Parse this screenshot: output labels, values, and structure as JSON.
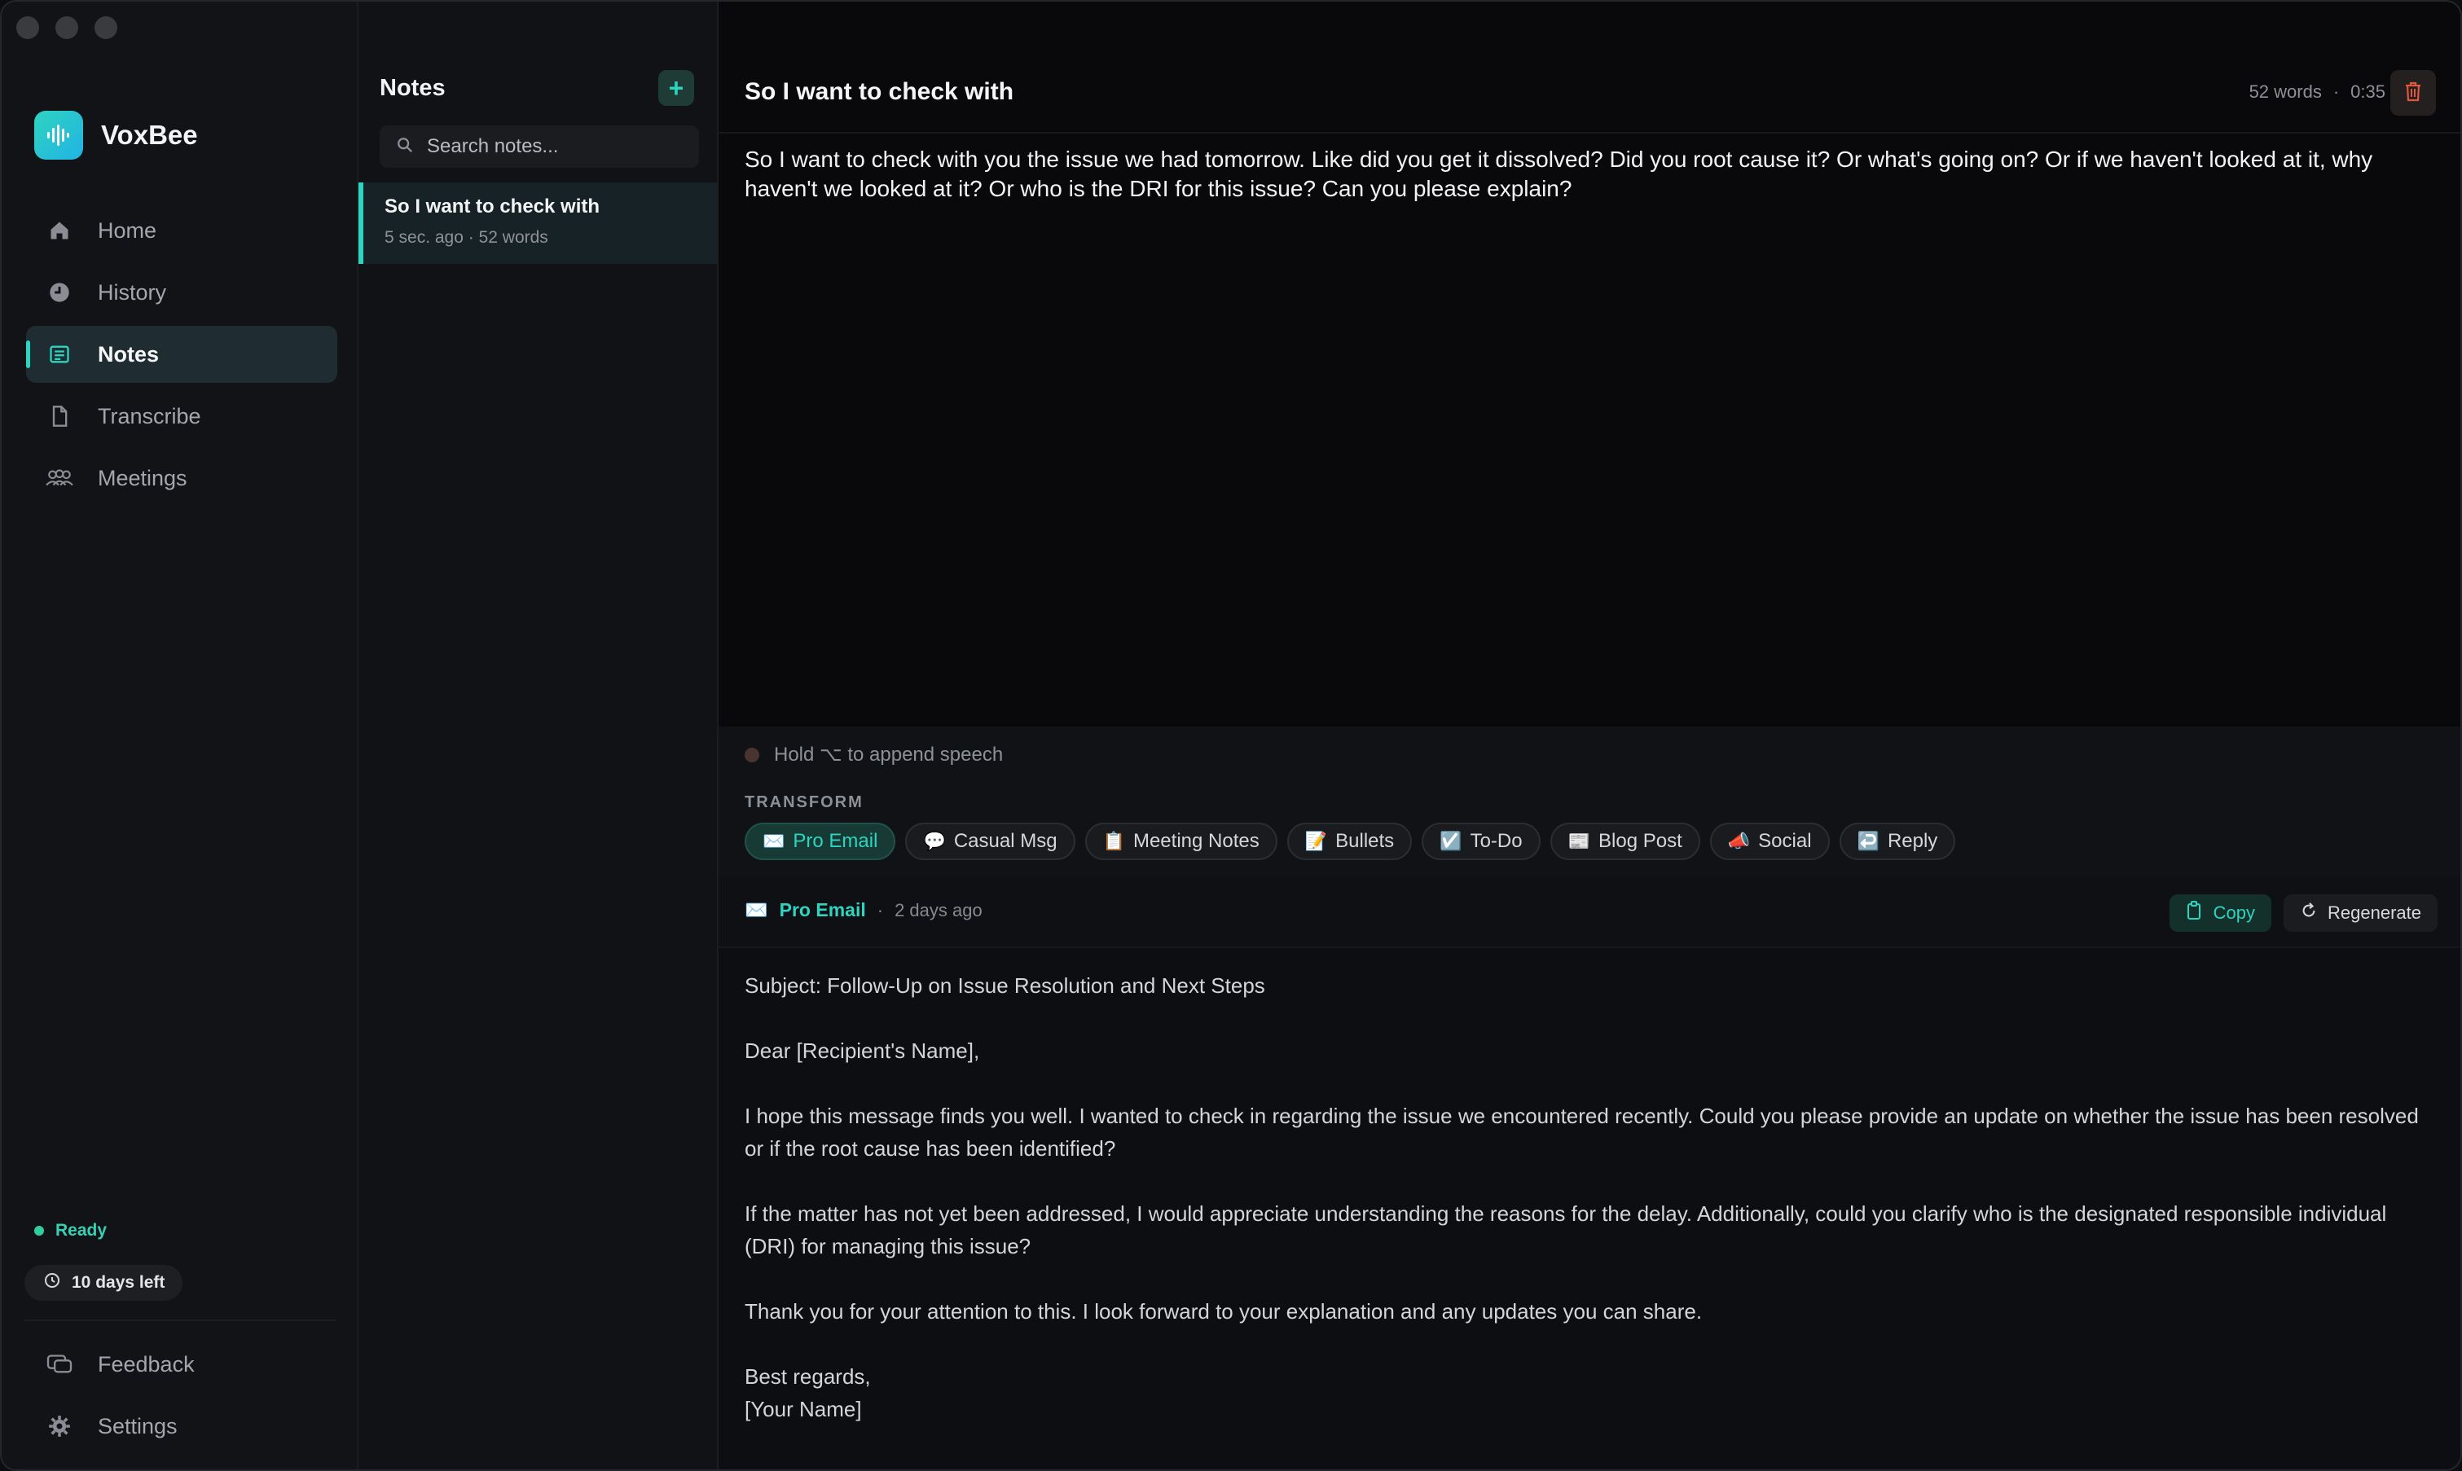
{
  "app": {
    "name": "VoxBee"
  },
  "sidebar": {
    "items": [
      {
        "label": "Home",
        "icon": "home-icon"
      },
      {
        "label": "History",
        "icon": "history-icon"
      },
      {
        "label": "Notes",
        "icon": "notes-icon",
        "active": true
      },
      {
        "label": "Transcribe",
        "icon": "file-icon"
      },
      {
        "label": "Meetings",
        "icon": "people-icon"
      }
    ],
    "status": "Ready",
    "trial": "10 days left",
    "bottom": [
      {
        "label": "Feedback",
        "icon": "feedback-icon"
      },
      {
        "label": "Settings",
        "icon": "gear-icon"
      }
    ]
  },
  "notes": {
    "title": "Notes",
    "add": "+",
    "search_placeholder": "Search notes...",
    "list": [
      {
        "title": "So I want to check with",
        "time": "5 sec. ago",
        "sep": "·",
        "words": "52 words"
      }
    ]
  },
  "doc": {
    "title": "So I want to check with",
    "words": "52 words",
    "sep": "·",
    "duration": "0:35",
    "transcript": "So I want to check with you the issue we had tomorrow. Like did you get it dissolved? Did you root cause it? Or what's going on? Or if we haven't looked at it, why haven't we looked at it? Or who is the DRI for this issue? Can you please explain?"
  },
  "append": {
    "hint": "Hold ⌥ to append speech"
  },
  "transform": {
    "label": "TRANSFORM",
    "chips": [
      {
        "emoji": "✉️",
        "label": "Pro Email",
        "active": true
      },
      {
        "emoji": "💬",
        "label": "Casual Msg"
      },
      {
        "emoji": "📋",
        "label": "Meeting Notes"
      },
      {
        "emoji": "📝",
        "label": "Bullets"
      },
      {
        "emoji": "☑️",
        "label": "To-Do"
      },
      {
        "emoji": "📰",
        "label": "Blog Post"
      },
      {
        "emoji": "📣",
        "label": "Social"
      },
      {
        "emoji": "↩️",
        "label": "Reply"
      }
    ]
  },
  "result": {
    "emoji": "✉️",
    "name": "Pro Email",
    "sep": "·",
    "ago": "2 days ago",
    "copy": "Copy",
    "regenerate": "Regenerate",
    "paragraphs": [
      "Subject: Follow-Up on Issue Resolution and Next Steps",
      "Dear [Recipient's Name],",
      "I hope this message finds you well. I wanted to check in regarding the issue we encountered recently. Could you please provide an update on whether the issue has been resolved or if the root cause has been identified?",
      "If the matter has not yet been addressed, I would appreciate understanding the reasons for the delay. Additionally, could you clarify who is the designated responsible individual (DRI) for managing this issue?",
      "Thank you for your attention to this. I look forward to your explanation and any updates you can share."
    ],
    "closing": "Best regards,",
    "signature": "[Your Name]"
  },
  "colors": {
    "accent": "#2dd4bf",
    "danger": "#e0573f",
    "status": "#2fcf99"
  }
}
